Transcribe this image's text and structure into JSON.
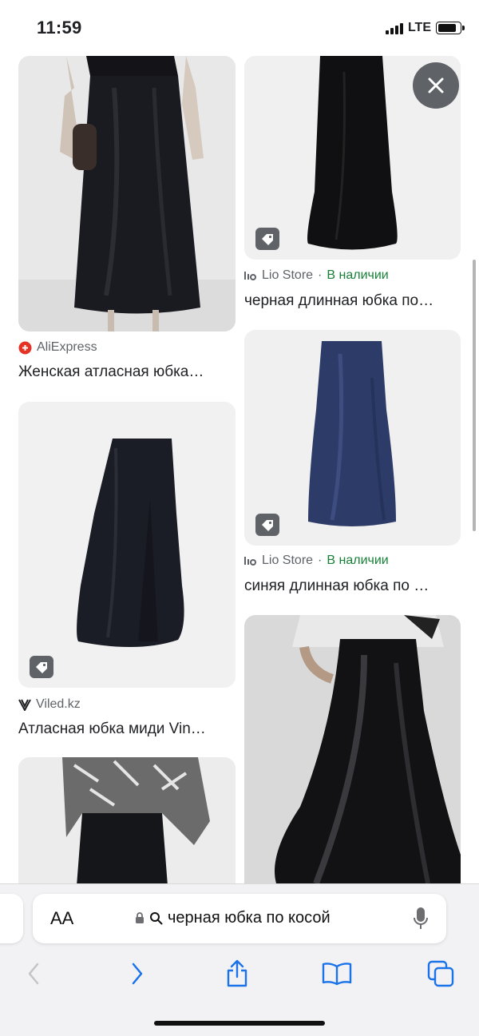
{
  "status": {
    "time": "11:59",
    "network": "LTE"
  },
  "results": [
    {
      "source": "AliExpress",
      "stock": "",
      "title": "Женская атласная юбка…"
    },
    {
      "source": "Lio Store",
      "separator": "·",
      "stock": "В наличии",
      "title": "черная длинная юбка по…"
    },
    {
      "source": "Viled.kz",
      "stock": "",
      "title": "Атласная юбка миди Vin…"
    },
    {
      "source": "Lio Store",
      "separator": "·",
      "stock": "В наличии",
      "title": "синяя длинная юбка по …"
    }
  ],
  "browser": {
    "text_size_label": "AA",
    "query": "черная юбка по косой"
  },
  "colors": {
    "in_stock": "#188038",
    "badge": "#5f6368",
    "card_bg": "#f1f1f1"
  }
}
